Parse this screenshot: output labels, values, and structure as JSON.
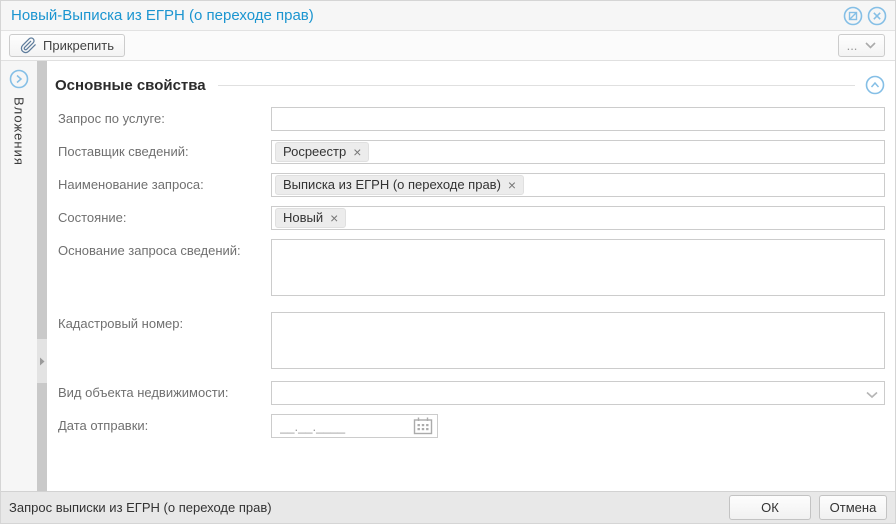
{
  "window": {
    "title": "Новый-Выписка из ЕГРН (о переходе прав)"
  },
  "colors": {
    "accent_blue": "#1b95d0",
    "icon_blue": "#85bfe6",
    "border_gray": "#cccccc",
    "label_gray": "#707070"
  },
  "toolbar": {
    "attach_label": "Прикрепить",
    "more_label": "..."
  },
  "sidebar": {
    "attachments_label": "Вложения"
  },
  "form": {
    "section_title": "Основные свойства",
    "fields": {
      "service_request": {
        "label": "Запрос по услуге:",
        "value": ""
      },
      "data_provider": {
        "label": "Поставщик сведений:",
        "tag": "Росреестр"
      },
      "request_name": {
        "label": "Наименование запроса:",
        "tag": "Выписка из ЕГРН (о переходе прав)"
      },
      "state": {
        "label": "Состояние:",
        "tag": "Новый"
      },
      "request_basis": {
        "label": "Основание запроса сведений:",
        "value": ""
      },
      "cadastral_number": {
        "label": "Кадастровый номер:",
        "value": ""
      },
      "property_type": {
        "label": "Вид объекта недвижимости:",
        "value": ""
      },
      "send_date": {
        "label": "Дата отправки:",
        "mask": "__.__.____",
        "value": ""
      }
    }
  },
  "icons": {
    "remove_tag_glyph": "×"
  },
  "footer": {
    "status_text": "Запрос выписки из ЕГРН (о переходе прав)",
    "ok_label": "ОК",
    "cancel_label": "Отмена"
  }
}
